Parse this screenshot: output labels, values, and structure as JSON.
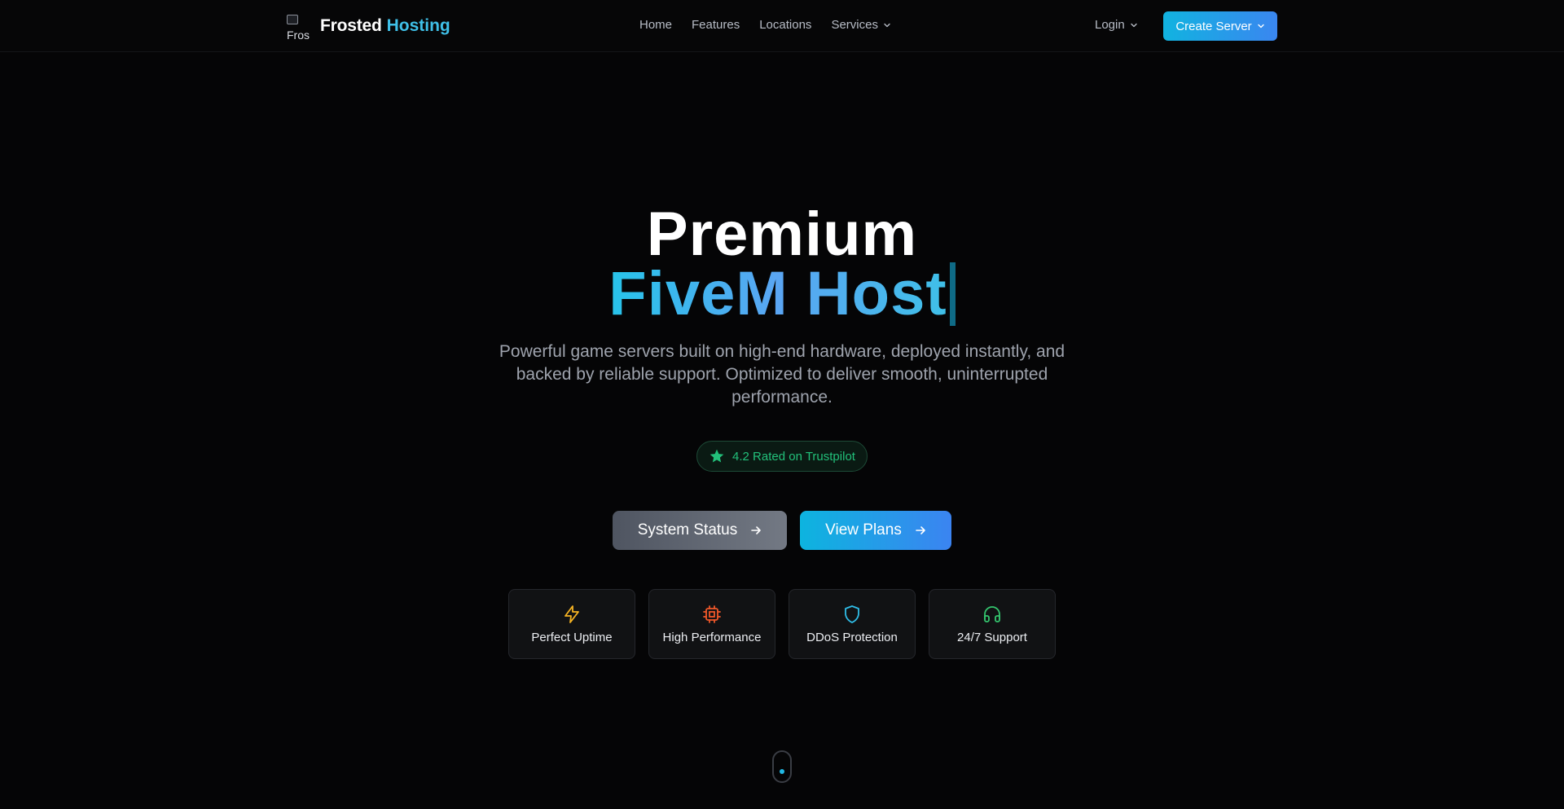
{
  "navbar": {
    "logo_alt": "Fros",
    "brand_name": "Frosted",
    "brand_accent": "Hosting",
    "links": [
      {
        "label": "Home"
      },
      {
        "label": "Features"
      },
      {
        "label": "Locations"
      },
      {
        "label": "Services"
      }
    ],
    "login_label": "Login",
    "create_server_label": "Create Server"
  },
  "hero": {
    "title_line1": "Premium",
    "title_line2": "FiveM Host",
    "subtitle": "Powerful game servers built on high-end hardware, deployed instantly, and backed by reliable support. Optimized to deliver smooth, uninterrupted performance.",
    "trust_text": "4.2 Rated on Trustpilot",
    "buttons": {
      "status_label": "System Status",
      "plans_label": "View Plans"
    }
  },
  "features": [
    {
      "label": "Perfect Uptime",
      "icon": "lightning-icon",
      "color": "#f5b323"
    },
    {
      "label": "High Performance",
      "icon": "cpu-icon",
      "color": "#f0582a"
    },
    {
      "label": "DDoS Protection",
      "icon": "shield-icon",
      "color": "#2fbde8"
    },
    {
      "label": "24/7 Support",
      "icon": "headphones-icon",
      "color": "#34c56e"
    }
  ],
  "colors": {
    "accent": "#3fc0e8",
    "primary_gradient_start": "#11b3e0",
    "primary_gradient_end": "#3a86f0",
    "trust_green": "#22c07a"
  }
}
